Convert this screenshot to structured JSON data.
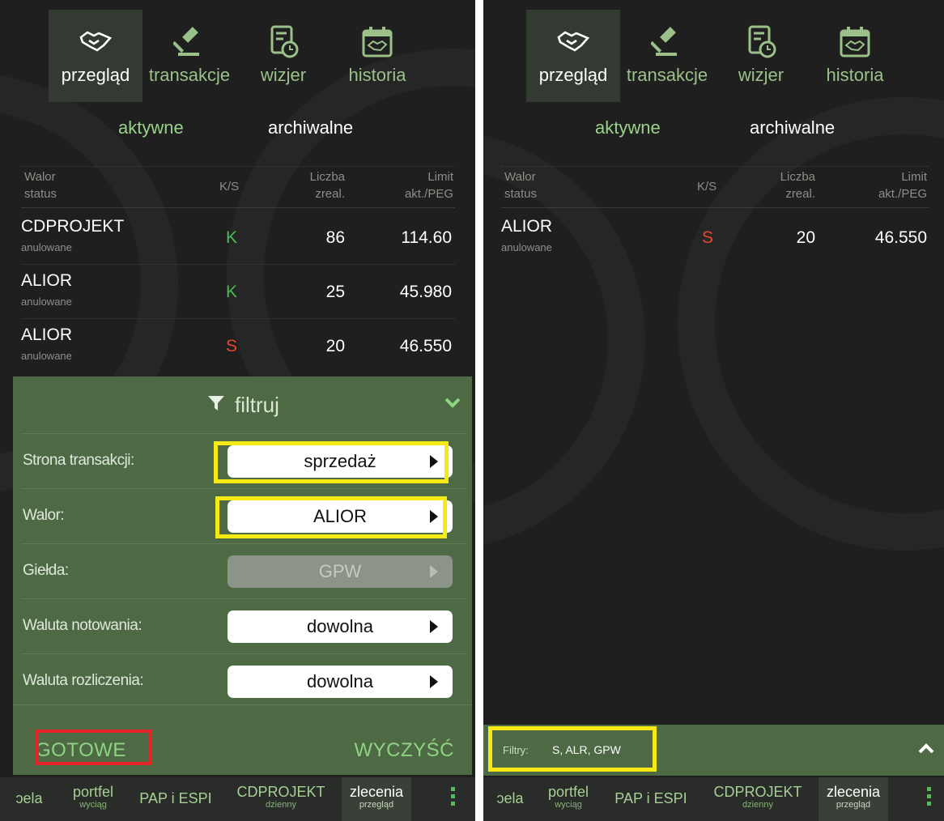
{
  "tabs": [
    {
      "label": "przegląd",
      "icon": "handshake-icon",
      "active": true
    },
    {
      "label": "transakcje",
      "icon": "gavel-icon",
      "active": false
    },
    {
      "label": "wizjer",
      "icon": "clock-document-icon",
      "active": false
    },
    {
      "label": "historia",
      "icon": "calendar-handshake-icon",
      "active": false
    }
  ],
  "segments": {
    "active": "aktywne",
    "archived": "archiwalne"
  },
  "table_header": {
    "walor": "Walor",
    "status": "status",
    "ks": "K/S",
    "liczba": "Liczba",
    "zreal": "zreal.",
    "limit": "Limit",
    "akt_peg": "akt./PEG"
  },
  "left_orders": [
    {
      "name": "CDPROJEKT",
      "status": "anulowane",
      "side": "K",
      "qty": "86",
      "limit": "114.60"
    },
    {
      "name": "ALIOR",
      "status": "anulowane",
      "side": "K",
      "qty": "25",
      "limit": "45.980"
    },
    {
      "name": "ALIOR",
      "status": "anulowane",
      "side": "S",
      "qty": "20",
      "limit": "46.550"
    }
  ],
  "right_orders": [
    {
      "name": "ALIOR",
      "status": "anulowane",
      "side": "S",
      "qty": "20",
      "limit": "46.550"
    }
  ],
  "filter": {
    "title": "filtruj",
    "rows": [
      {
        "label": "Strona transakcji:",
        "value": "sprzedaż",
        "disabled": false
      },
      {
        "label": "Walor:",
        "value": "ALIOR",
        "disabled": false
      },
      {
        "label": "Giełda:",
        "value": "GPW",
        "disabled": true
      },
      {
        "label": "Waluta notowania:",
        "value": "dowolna",
        "disabled": false
      },
      {
        "label": "Waluta rozliczenia:",
        "value": "dowolna",
        "disabled": false
      }
    ],
    "done": "GOTOWE",
    "clear": "WYCZYŚĆ"
  },
  "filter_bar": {
    "label": "Filtry:",
    "value": "S, ALR, GPW"
  },
  "bottom_nav": [
    {
      "label": "ɔela",
      "sub": ""
    },
    {
      "label": "portfel",
      "sub": "wyciąg"
    },
    {
      "label": "PAP i ESPI",
      "sub": ""
    },
    {
      "label": "CDPROJEKT",
      "sub": "dzienny"
    },
    {
      "label": "zlecenia",
      "sub": "przegląd"
    }
  ],
  "colors": {
    "buy": "#4cba56",
    "sell": "#e8492e",
    "accent_green": "#9bd28a",
    "panel_green": "#4e6a45",
    "highlight_yellow": "#f6ea14",
    "highlight_red": "#e32326"
  }
}
